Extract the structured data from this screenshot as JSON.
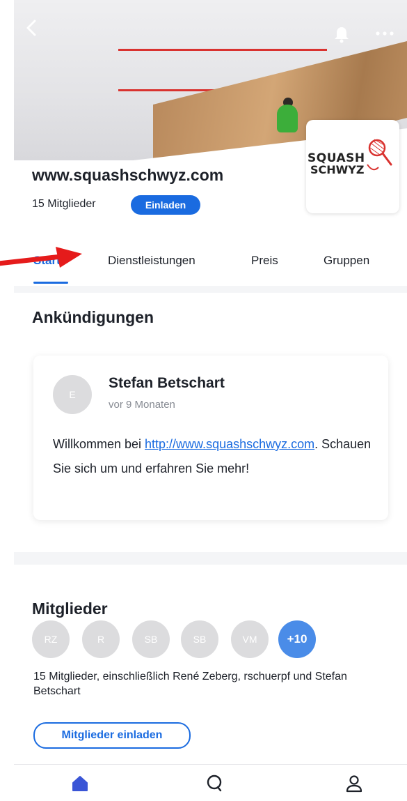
{
  "header": {
    "org_title": "www.squashschwyz.com",
    "members_count": "15 Mitglieder",
    "invite_label": "Einladen",
    "logo": {
      "line1": "SQUASH",
      "line2": "SCHWYZ"
    }
  },
  "tabs": [
    {
      "label": "Start"
    },
    {
      "label": "Dienstleistungen"
    },
    {
      "label": "Preis"
    },
    {
      "label": "Gruppen"
    }
  ],
  "announcements": {
    "title": "Ankündigungen",
    "post": {
      "avatar_initial": "E",
      "author": "Stefan Betschart",
      "time": "vor 9 Monaten",
      "text_before": "Willkommen bei ",
      "link": "http://www.squashschwyz.com",
      "text_after": ". Schauen Sie sich um und erfahren Sie mehr!"
    }
  },
  "members": {
    "title": "Mitglieder",
    "avatars": [
      "RZ",
      "R",
      "SB",
      "SB",
      "VM"
    ],
    "more": "+10",
    "description": "15 Mitglieder, einschließlich René Zeberg, rschuerpf und Stefan Betschart",
    "invite_button": "Mitglieder einladen"
  },
  "icons": {
    "back": "back-chevron-icon",
    "bell": "bell-icon",
    "more": "more-dots-icon",
    "home": "home-icon",
    "search": "search-icon",
    "profile": "profile-icon"
  },
  "colors": {
    "accent": "#1a6be0",
    "annotation_arrow": "#e51b1b"
  }
}
